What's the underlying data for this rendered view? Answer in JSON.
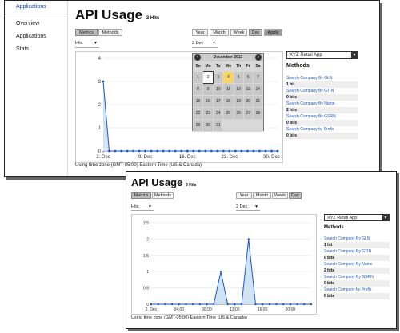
{
  "top": {
    "sidebar": {
      "header": "Applications",
      "items": [
        "Overview",
        "Applications",
        "Stats"
      ]
    },
    "title": "API Usage",
    "hits_count": "3 Hits",
    "tabs": [
      "Metrics",
      "Methods"
    ],
    "metric_select": "Hits",
    "ranges": [
      "Year",
      "Month",
      "Week",
      "Day"
    ],
    "apply_label": "Apply",
    "date_select": "2 Dec",
    "app_select": "XYZ Retail App",
    "methods_heading": "Methods",
    "methods": [
      {
        "name": "Search Company By GLN",
        "hits": "1 hit"
      },
      {
        "name": "Search Company By GTIN",
        "hits": "0 bits"
      },
      {
        "name": "Search Company By Name",
        "hits": "2 hits"
      },
      {
        "name": "Search Company By GSRN",
        "hits": "0 bits"
      },
      {
        "name": "Search Company by Prefix",
        "hits": "0 bits"
      }
    ],
    "timezone": "Using time zone (GMT-05:00) Eastern Time (US & Canada)",
    "calendar": {
      "month": "December 2013",
      "prev": "‹",
      "next": "›",
      "weekdays": [
        "Su",
        "Mo",
        "Tu",
        "We",
        "Th",
        "Fr",
        "Sa"
      ],
      "weeks": [
        [
          "1",
          "2",
          "3",
          "4",
          "5",
          "6",
          "7"
        ],
        [
          "8",
          "9",
          "10",
          "11",
          "12",
          "13",
          "14"
        ],
        [
          "15",
          "16",
          "17",
          "18",
          "19",
          "20",
          "21"
        ],
        [
          "22",
          "23",
          "24",
          "25",
          "26",
          "27",
          "28"
        ],
        [
          "29",
          "30",
          "31",
          "",
          "",
          "",
          ""
        ]
      ],
      "selected": "2",
      "today": "4"
    }
  },
  "bottom": {
    "title": "API Usage",
    "hits_count": "3 Hits",
    "tabs": [
      "Metrics",
      "Methods"
    ],
    "metric_select": "Hits",
    "ranges": [
      "Year",
      "Month",
      "Week",
      "Day"
    ],
    "date_select": "2 Dec",
    "app_select": "XYZ Retail App",
    "methods_heading": "Methods",
    "methods": [
      {
        "name": "Search Company By GLN",
        "hits": "1 hit"
      },
      {
        "name": "Search Company By GTIN",
        "hits": "0 bits"
      },
      {
        "name": "Search Company By Name",
        "hits": "2 hits"
      },
      {
        "name": "Search Company By GSRN",
        "hits": "0 bits"
      },
      {
        "name": "Search Company by Prefix",
        "hits": "0 bits"
      }
    ],
    "timezone": "Using time zone (GMT-05:00) Eastern Time (US & Canada)"
  },
  "colors": {
    "line": "#1f57c0",
    "fill": "#cfe3f3",
    "link": "#1f57c0"
  },
  "chart_data": [
    {
      "type": "area",
      "title": "",
      "xlabel": "",
      "ylabel": "",
      "x_ticks": [
        "2. Dec",
        "9. Dec",
        "16. Dec",
        "23. Dec",
        "30. Dec"
      ],
      "y_ticks": [
        "0",
        "1",
        "2",
        "3",
        "4"
      ],
      "ylim": [
        0,
        4
      ],
      "x": [
        "2. Dec",
        "3. Dec",
        "4. Dec",
        "5. Dec",
        "6. Dec",
        "7. Dec",
        "8. Dec",
        "9. Dec",
        "10. Dec",
        "11. Dec",
        "12. Dec",
        "13. Dec",
        "14. Dec",
        "15. Dec",
        "16. Dec",
        "17. Dec",
        "18. Dec",
        "19. Dec",
        "20. Dec",
        "21. Dec",
        "22. Dec",
        "23. Dec",
        "24. Dec",
        "25. Dec",
        "26. Dec",
        "27. Dec",
        "28. Dec",
        "29. Dec",
        "30. Dec",
        "31. Dec"
      ],
      "series": [
        {
          "values": [
            3,
            0,
            0,
            0,
            0,
            0,
            0,
            0,
            0,
            0,
            0,
            0,
            0,
            0,
            0,
            0,
            0,
            0,
            0,
            0,
            0,
            0,
            0,
            0,
            0,
            0,
            0,
            0,
            0,
            0
          ]
        }
      ]
    },
    {
      "type": "area",
      "title": "",
      "xlabel": "",
      "ylabel": "",
      "x_ticks": [
        "2. Dec",
        "04:00",
        "08:00",
        "12:00",
        "16:00",
        "20:00"
      ],
      "y_ticks": [
        "0",
        "0.5",
        "1",
        "1.5",
        "2",
        "2.5"
      ],
      "ylim": [
        0,
        2.5
      ],
      "x": [
        "00:00",
        "01:00",
        "02:00",
        "03:00",
        "04:00",
        "05:00",
        "06:00",
        "07:00",
        "08:00",
        "09:00",
        "10:00",
        "11:00",
        "12:00",
        "13:00",
        "14:00",
        "15:00",
        "16:00",
        "17:00",
        "18:00",
        "19:00",
        "20:00",
        "21:00",
        "22:00",
        "23:00"
      ],
      "series": [
        {
          "values": [
            0,
            0,
            0,
            0,
            0,
            0,
            0,
            0,
            0,
            0,
            1,
            0,
            0,
            0,
            2,
            0,
            0,
            0,
            0,
            0,
            0,
            0,
            0,
            0
          ]
        }
      ]
    }
  ]
}
